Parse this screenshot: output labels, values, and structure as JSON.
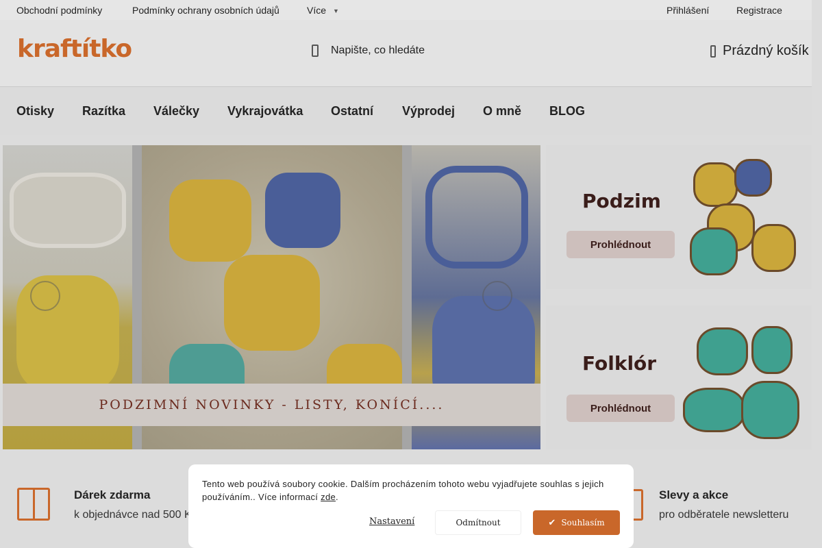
{
  "topbar": {
    "links": [
      "Obchodní podmínky",
      "Podmínky ochrany osobních údajů",
      "Více"
    ],
    "more_chevron": "chevron-down-icon",
    "login": "Přihlášení",
    "register": "Registrace"
  },
  "header": {
    "logo": "kraftítko",
    "search_placeholder": "Napište, co hledáte",
    "cart_label": "Prázdný košík"
  },
  "nav": {
    "items": [
      "Otisky",
      "Razítka",
      "Válečky",
      "Vykrajovátka",
      "Ostatní",
      "Výprodej",
      "O mně",
      "BLOG"
    ]
  },
  "hero": {
    "caption": "PODZIMNÍ NOVINKY - LISTY, KONÍCÍ...."
  },
  "promos": [
    {
      "title": "Podzim",
      "button": "Prohlédnout"
    },
    {
      "title": "Folklór",
      "button": "Prohlédnout"
    }
  ],
  "benefits": {
    "gift_title": "Dárek zdarma",
    "gift_sub": "k objednávce nad 500 K",
    "sale_title": "Slevy a akce",
    "sale_sub": "pro odběratele newsletteru"
  },
  "cookie": {
    "text": "Tento web používá soubory cookie. Dalším procházením tohoto webu vyjadřujete souhlas s jejich používáním.. Více informací",
    "link": "zde",
    "settings": "Nastavení",
    "decline": "Odmítnout",
    "accept": "Souhlasím"
  },
  "colors": {
    "accent": "#c9672a"
  }
}
